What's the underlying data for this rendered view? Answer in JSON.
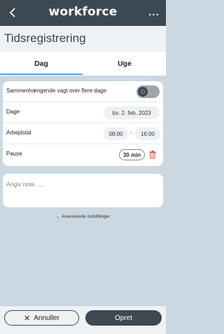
{
  "header": {
    "brand": "workforce",
    "back_icon": "chevron-left-icon",
    "more_icon": "more-horizontal-icon",
    "more_label": "..."
  },
  "page": {
    "title": "Tidsregistrering"
  },
  "tabs": [
    {
      "label": "Dag",
      "active": true
    },
    {
      "label": "Uge",
      "active": false
    }
  ],
  "form": {
    "multi_day_label": "Sammenhængende vagt over flere dage",
    "multi_day_enabled": false,
    "date_label": "Dage",
    "date_value": "tor. 2. feb. 2023",
    "worktime_label": "Arbejdstid",
    "start_time": "08:00",
    "separator": "-",
    "end_time": "16:00",
    "pause_label": "Pause",
    "pause_value": "30 min",
    "delete_icon": "trash-icon"
  },
  "note": {
    "placeholder": "Angiv note......"
  },
  "advanced": {
    "label": "Avancerede indstillinger",
    "icon": "chevron-down-icon",
    "chevron": "⌄"
  },
  "footer": {
    "cancel_label": "Annuller",
    "cancel_icon": "close-icon",
    "cancel_x": "✕",
    "create_label": "Opret"
  },
  "colors": {
    "header_bg": "#3c4852",
    "accent": "#5a9ed6",
    "delete": "#d9534f",
    "page_bg": "#ccd8e1"
  }
}
